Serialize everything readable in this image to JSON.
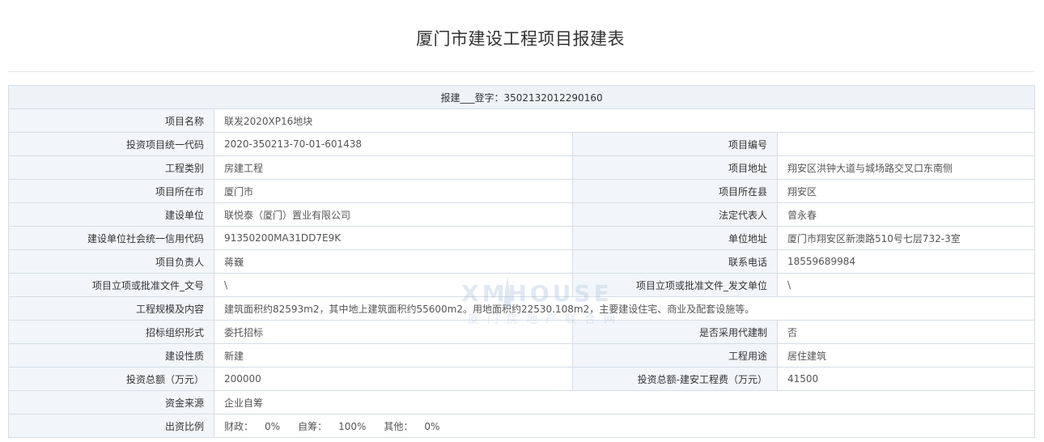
{
  "title": "厦门市建设工程项目报建表",
  "registration": "报建___登字：3502132012290160",
  "rows": [
    {
      "label": "项目名称",
      "value": "联发2020XP16地块"
    },
    {
      "label": "投资项目统一代码",
      "value": "2020-350213-70-01-601438",
      "label2": "项目编号",
      "value2": ""
    },
    {
      "label": "工程类别",
      "value": "房建工程",
      "label2": "项目地址",
      "value2": "翔安区洪钟大道与城场路交叉口东南侧"
    },
    {
      "label": "项目所在市",
      "value": "厦门市",
      "label2": "项目所在县",
      "value2": "翔安区"
    },
    {
      "label": "建设单位",
      "value": "联悦泰（厦门）置业有限公司",
      "label2": "法定代表人",
      "value2": "曾永春"
    },
    {
      "label": "建设单位社会统一信用代码",
      "value": "91350200MA31DD7E9K",
      "label2": "单位地址",
      "value2": "厦门市翔安区新澳路510号七层732-3室"
    },
    {
      "label": "项目负责人",
      "value": "蒋巍",
      "label2": "联系电话",
      "value2": "18559689984"
    },
    {
      "label": "项目立项或批准文件_文号",
      "value": "\\",
      "label2": "项目立项或批准文件_发文单位",
      "value2": "\\"
    },
    {
      "label": "工程规模及内容",
      "value": "建筑面积约82593m2，其中地上建筑面积约55600m2。用地面积约22530.108m2，主要建设住宅、商业及配套设施等。"
    },
    {
      "label": "招标组织形式",
      "value": "委托招标",
      "label2": "是否采用代建制",
      "value2": "否"
    },
    {
      "label": "建设性质",
      "value": "新建",
      "label2": "工程用途",
      "value2": "居住建筑"
    },
    {
      "label": "投资总额（万元）",
      "value": "200000",
      "label2": "投资总额-建安工程费（万元）",
      "value2": "41500"
    },
    {
      "label": "资金来源",
      "value": "企业自筹"
    }
  ],
  "funding_ratio": {
    "label": "出资比例",
    "items": [
      {
        "name": "财政：",
        "value": "0%"
      },
      {
        "name": "自筹：",
        "value": "100%"
      },
      {
        "name": "其他：",
        "value": "0%"
      }
    ]
  },
  "watermark": {
    "logo": "XMHOUSE",
    "text": "厦门房地产联合网"
  }
}
